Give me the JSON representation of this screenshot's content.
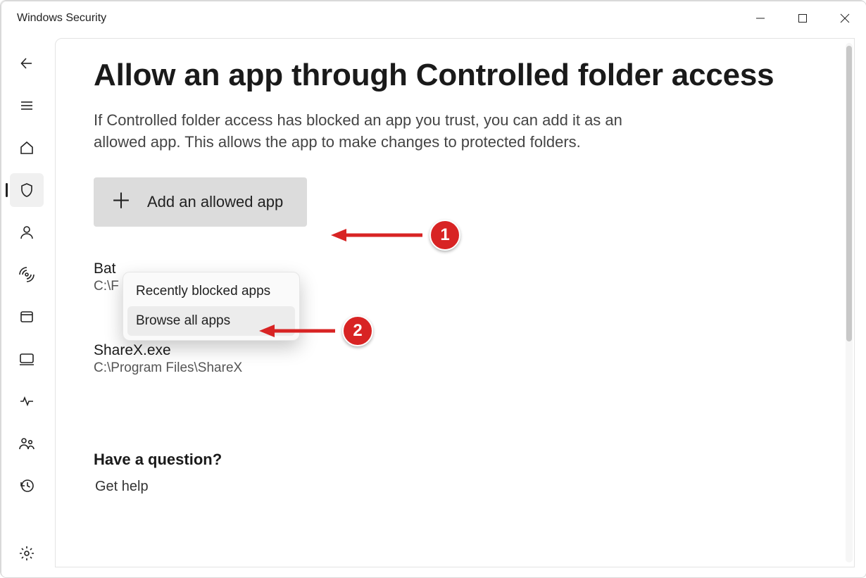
{
  "window": {
    "title": "Windows Security"
  },
  "page": {
    "heading": "Allow an app through Controlled folder access",
    "description": "If Controlled folder access has blocked an app you trust, you can add it as an allowed app. This allows the app to make changes to protected folders.",
    "add_button_label": "Add an allowed app",
    "menu": {
      "recently_blocked": "Recently blocked apps",
      "browse_all": "Browse all apps"
    },
    "apps": [
      {
        "name": "Bat",
        "path": "C:\\F"
      },
      {
        "name": "ShareX.exe",
        "path": "C:\\Program Files\\ShareX"
      }
    ],
    "question_heading": "Have a question?",
    "get_help": "Get help"
  },
  "annotations": {
    "step1": "1",
    "step2": "2"
  }
}
